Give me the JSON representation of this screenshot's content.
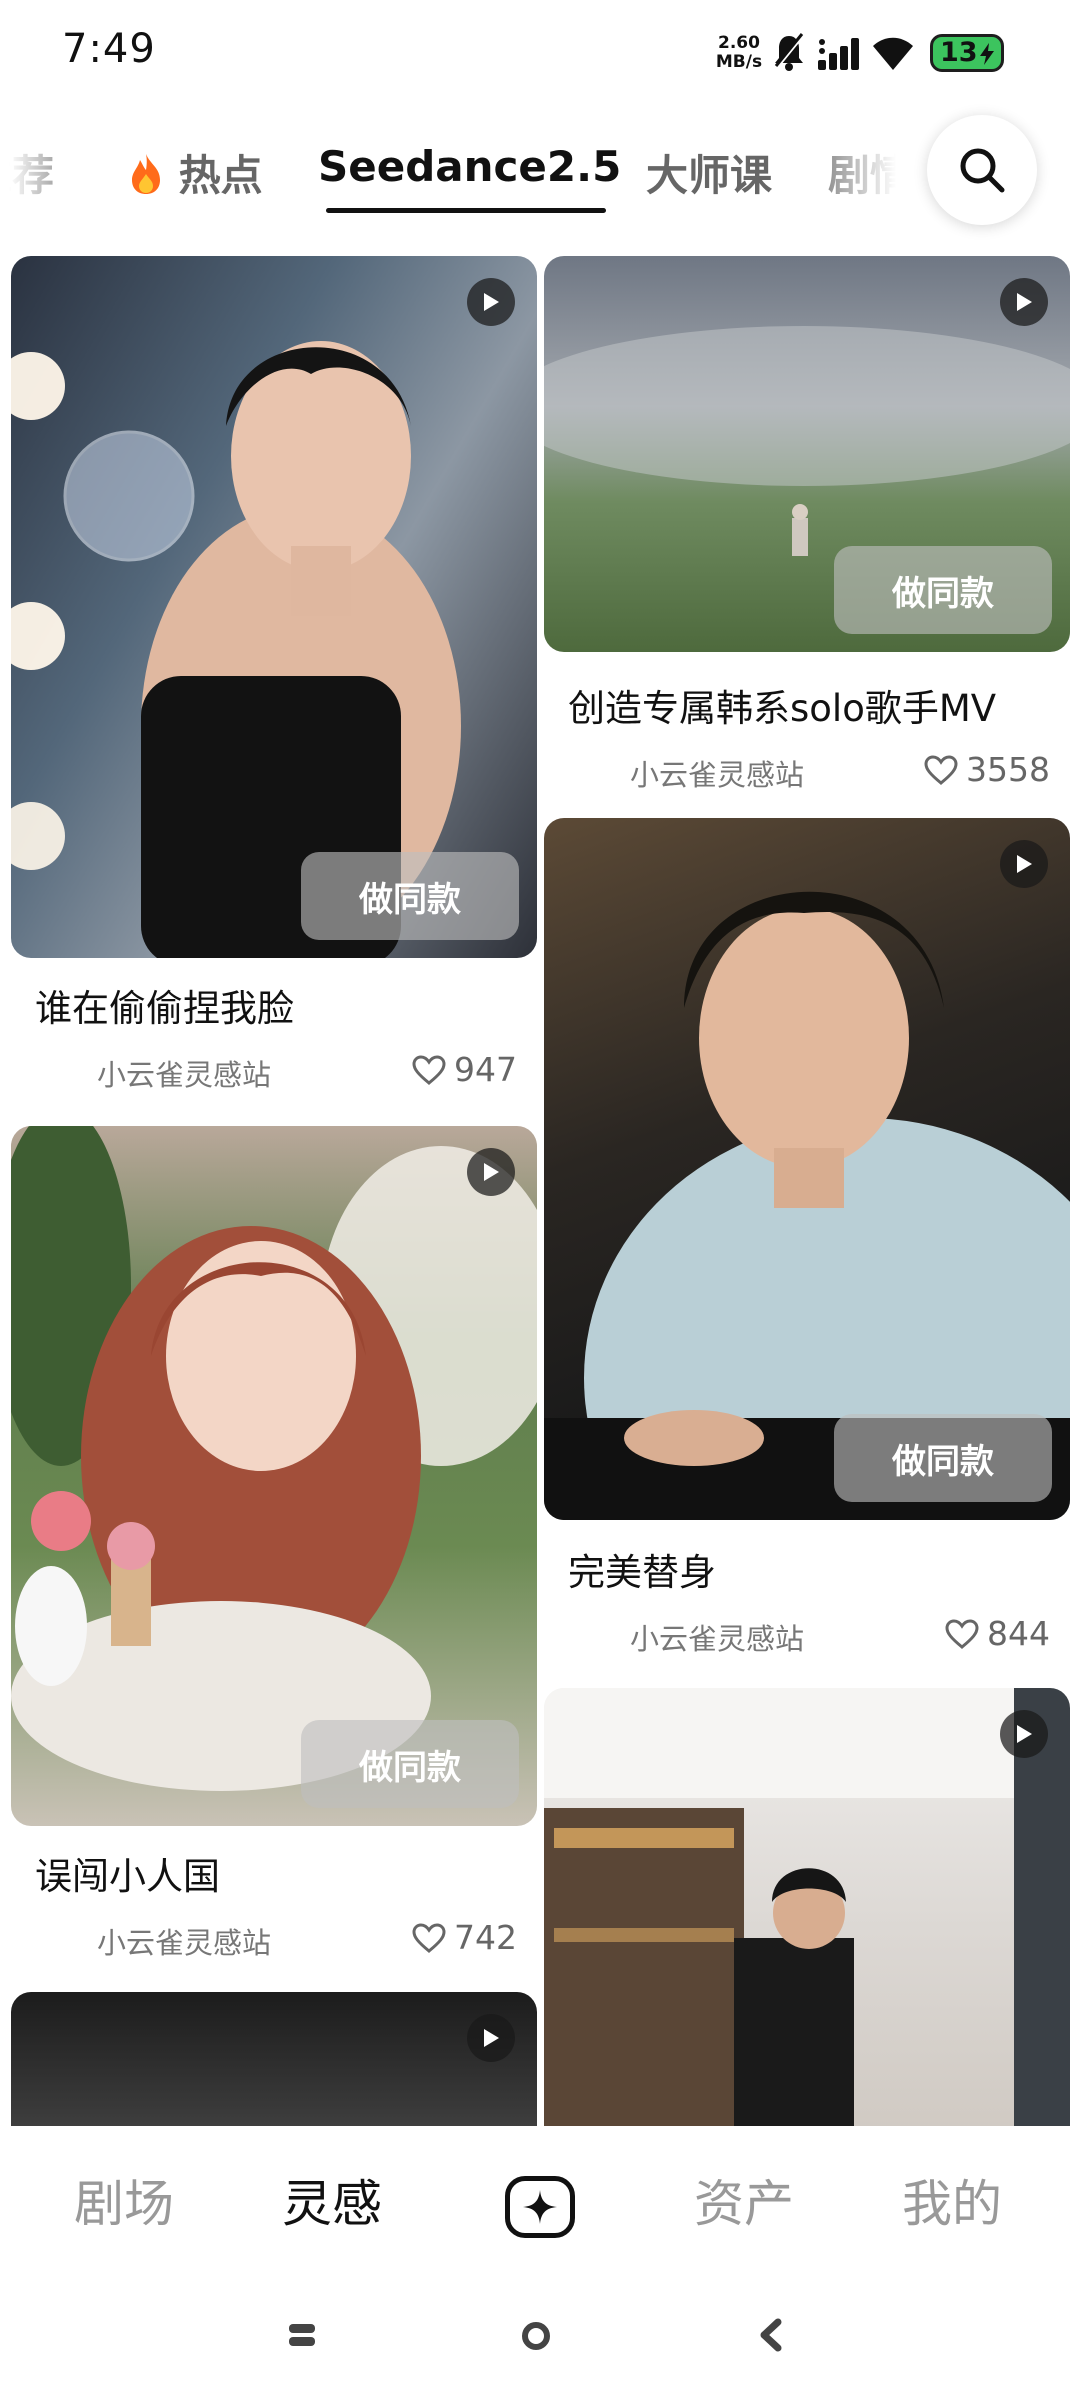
{
  "status_bar": {
    "time": "7:49",
    "speed_value": "2.60",
    "speed_unit": "MB/s",
    "battery": "13",
    "icons": [
      "dnd-bell-icon",
      "signal-icon",
      "wifi-icon",
      "battery-icon"
    ]
  },
  "tabs": [
    {
      "label": "推荐",
      "active": false
    },
    {
      "label": "热点",
      "icon": "fire-icon",
      "active": false
    },
    {
      "label": "Seedance2.5",
      "active": true
    },
    {
      "label": "大师课",
      "active": false
    },
    {
      "label": "剧情",
      "active": false
    }
  ],
  "feed": {
    "remix_label": "做同款",
    "left_column": [
      {
        "title": "谁在偷偷捏我脸",
        "author": "小云雀灵感站",
        "likes": "947"
      },
      {
        "title": "误闯小人国",
        "author": "小云雀灵感站",
        "likes": "742"
      },
      {
        "title": "",
        "author": "",
        "likes": ""
      }
    ],
    "right_column": [
      {
        "title": "创造专属韩系solo歌手MV",
        "author": "小云雀灵感站",
        "likes": "3558"
      },
      {
        "title": "完美替身",
        "author": "小云雀灵感站",
        "likes": "844"
      },
      {
        "title": "",
        "author": "",
        "likes": ""
      }
    ]
  },
  "bottom_nav": [
    {
      "label": "剧场",
      "active": false
    },
    {
      "label": "灵感",
      "active": true
    },
    {
      "label": "",
      "icon": "create-sparkle-icon",
      "active": false
    },
    {
      "label": "资产",
      "active": false
    },
    {
      "label": "我的",
      "active": false
    }
  ],
  "colors": {
    "accent_text": "#111111",
    "inactive_text": "#999999",
    "battery_green": "#3cc45e"
  }
}
